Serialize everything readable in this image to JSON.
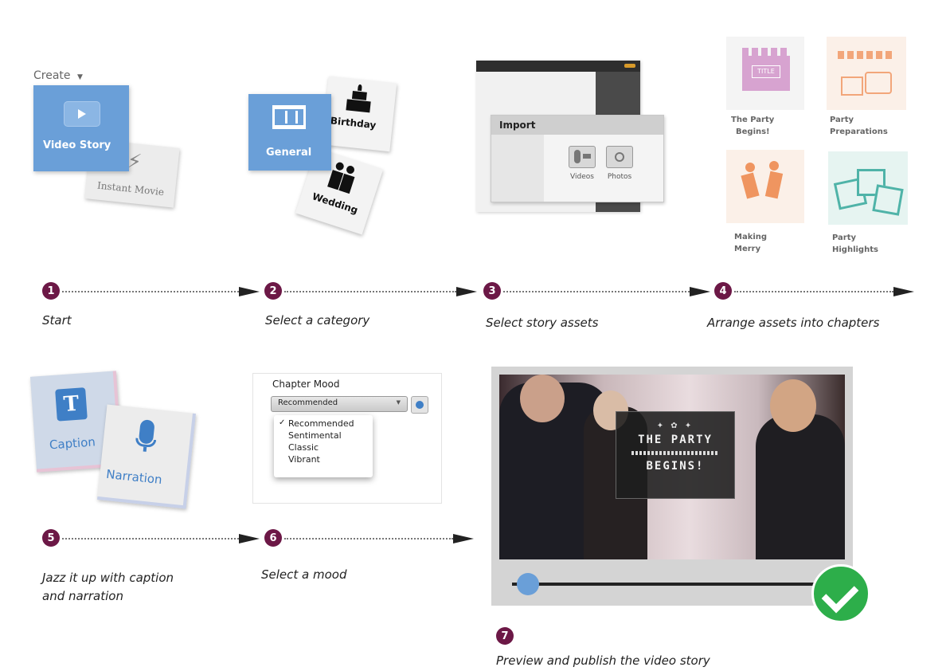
{
  "step1": {
    "num": "1",
    "label": "Start",
    "create": "Create",
    "video_story": "Video Story",
    "instant_movie": "Instant Movie"
  },
  "step2": {
    "num": "2",
    "label": "Select a category",
    "general": "General",
    "birthday": "Birthday",
    "wedding": "Wedding"
  },
  "step3": {
    "num": "3",
    "label": "Select story assets",
    "import": "Import",
    "videos": "Videos",
    "photos": "Photos"
  },
  "step4": {
    "num": "4",
    "label": "Arrange assets into chapters",
    "title_badge": "TITLE",
    "chapters": [
      {
        "line1": "The Party",
        "line2": "Begins!"
      },
      {
        "line1": "Party",
        "line2": "Preparations"
      },
      {
        "line1": "Making",
        "line2": "Merry"
      },
      {
        "line1": "Party",
        "line2": "Highlights"
      }
    ]
  },
  "step5": {
    "num": "5",
    "label_line1": "Jazz it up with caption",
    "label_line2": "and narration",
    "caption": "Caption",
    "narration": "Narration"
  },
  "step6": {
    "num": "6",
    "label": "Select a mood",
    "chapter_mood": "Chapter Mood",
    "selected": "Recommended",
    "options": [
      "Recommended",
      "Sentimental",
      "Classic",
      "Vibrant"
    ]
  },
  "step7": {
    "num": "7",
    "label": "Preview and publish the video story",
    "title_line1": "THE PARTY",
    "title_line2": "BEGINS!",
    "progress": 0.04
  },
  "colors": {
    "accent_blue": "#6a9fd8",
    "step_badge": "#6c1846",
    "success": "#2dae4a"
  }
}
